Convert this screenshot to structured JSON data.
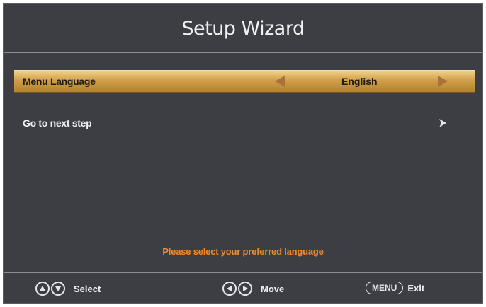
{
  "header": {
    "title": "Setup Wizard"
  },
  "menu": {
    "items": [
      {
        "label": "Menu Language",
        "value": "English",
        "selected": true
      },
      {
        "label": "Go to next step",
        "selected": false
      }
    ]
  },
  "hint": "Please select your preferred language",
  "footer": {
    "select_label": "Select",
    "move_label": "Move",
    "menu_key": "MENU",
    "exit_label": "Exit"
  },
  "colors": {
    "background": "#3c3e44",
    "selected_row_gold": "#cf9f4a",
    "hint_orange": "#f08a2a",
    "text_light": "#f0f0f0"
  },
  "icons": [
    "arrow-left-icon",
    "arrow-right-icon",
    "chevron-right-icon",
    "up-icon",
    "down-icon",
    "left-icon",
    "right-icon"
  ]
}
